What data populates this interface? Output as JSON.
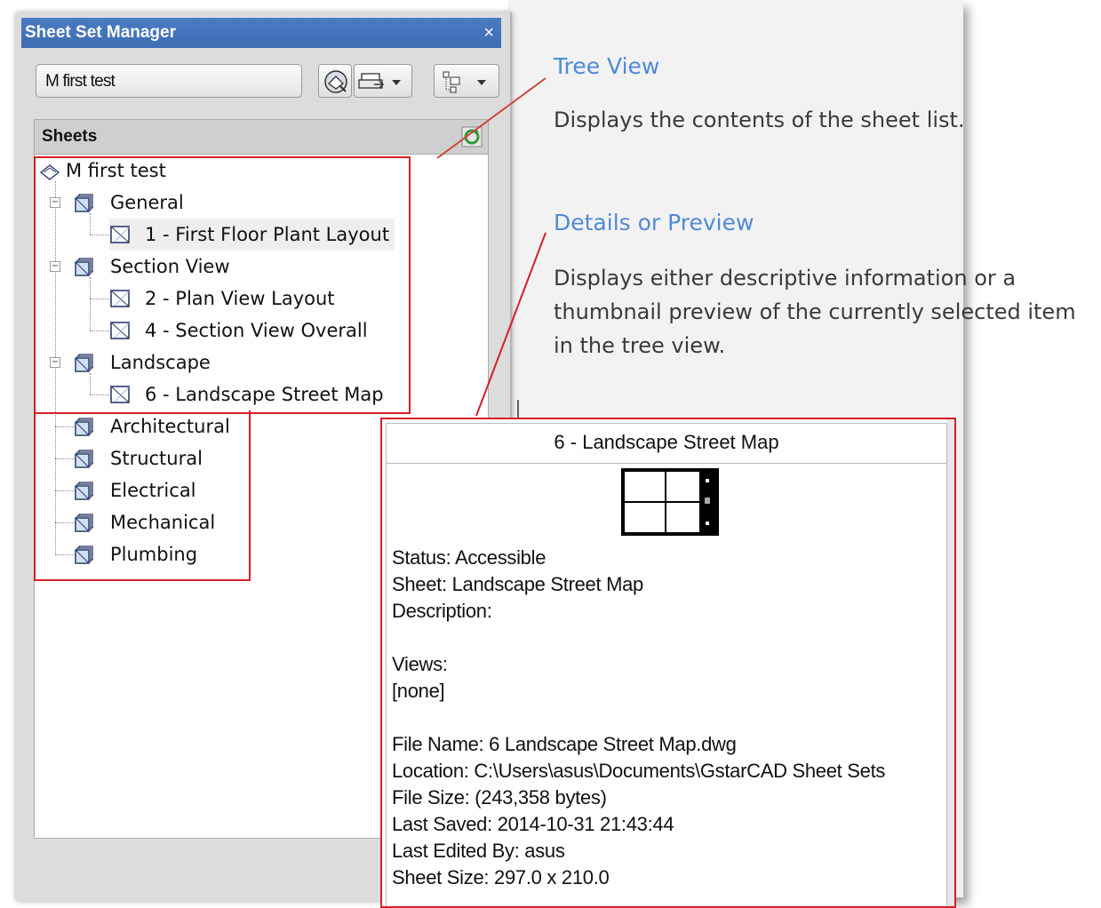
{
  "window": {
    "title": "Sheet Set Manager",
    "close_glyph": "×"
  },
  "toolbar": {
    "sheet_set_name": "M first test"
  },
  "sheets_panel": {
    "header": "Sheets"
  },
  "tree": {
    "root": "M first test",
    "items": [
      {
        "label": "General"
      },
      {
        "label": "1 - First Floor Plant Layout"
      },
      {
        "label": "Section View"
      },
      {
        "label": "2 - Plan View Layout"
      },
      {
        "label": "4 - Section View Overall"
      },
      {
        "label": "Landscape"
      },
      {
        "label": "6 - Landscape Street Map"
      },
      {
        "label": "Architectural"
      },
      {
        "label": "Structural"
      },
      {
        "label": "Electrical"
      },
      {
        "label": "Mechanical"
      },
      {
        "label": "Plumbing"
      }
    ]
  },
  "annotations": {
    "tree_view": {
      "title": "Tree View",
      "text": "Displays the contents of the sheet list."
    },
    "details": {
      "title": "Details or Preview",
      "lines": [
        "Displays either descriptive information or a",
        "thumbnail preview of the currently selected item",
        "in the tree view."
      ]
    }
  },
  "details_panel": {
    "title": "6 - Landscape Street Map",
    "status": "Status: Accessible",
    "sheet": "Sheet: Landscape Street Map",
    "description": "Description:",
    "views_label": "Views:",
    "views_value": "[none]",
    "file_name": "File Name: 6 Landscape Street Map.dwg",
    "location": "Location: C:\\Users\\asus\\Documents\\GstarCAD Sheet Sets",
    "file_size": "File Size:  (243,358 bytes)",
    "last_saved": "Last Saved: 2014-10-31 21:43:44",
    "last_edited_by": "Last Edited By: asus",
    "sheet_size": "Sheet Size: 297.0 x 210.0"
  },
  "colors": {
    "accent": "#4f8ad6",
    "highlight_border": "#d71f26",
    "titlebar": "#3d6cb3"
  }
}
